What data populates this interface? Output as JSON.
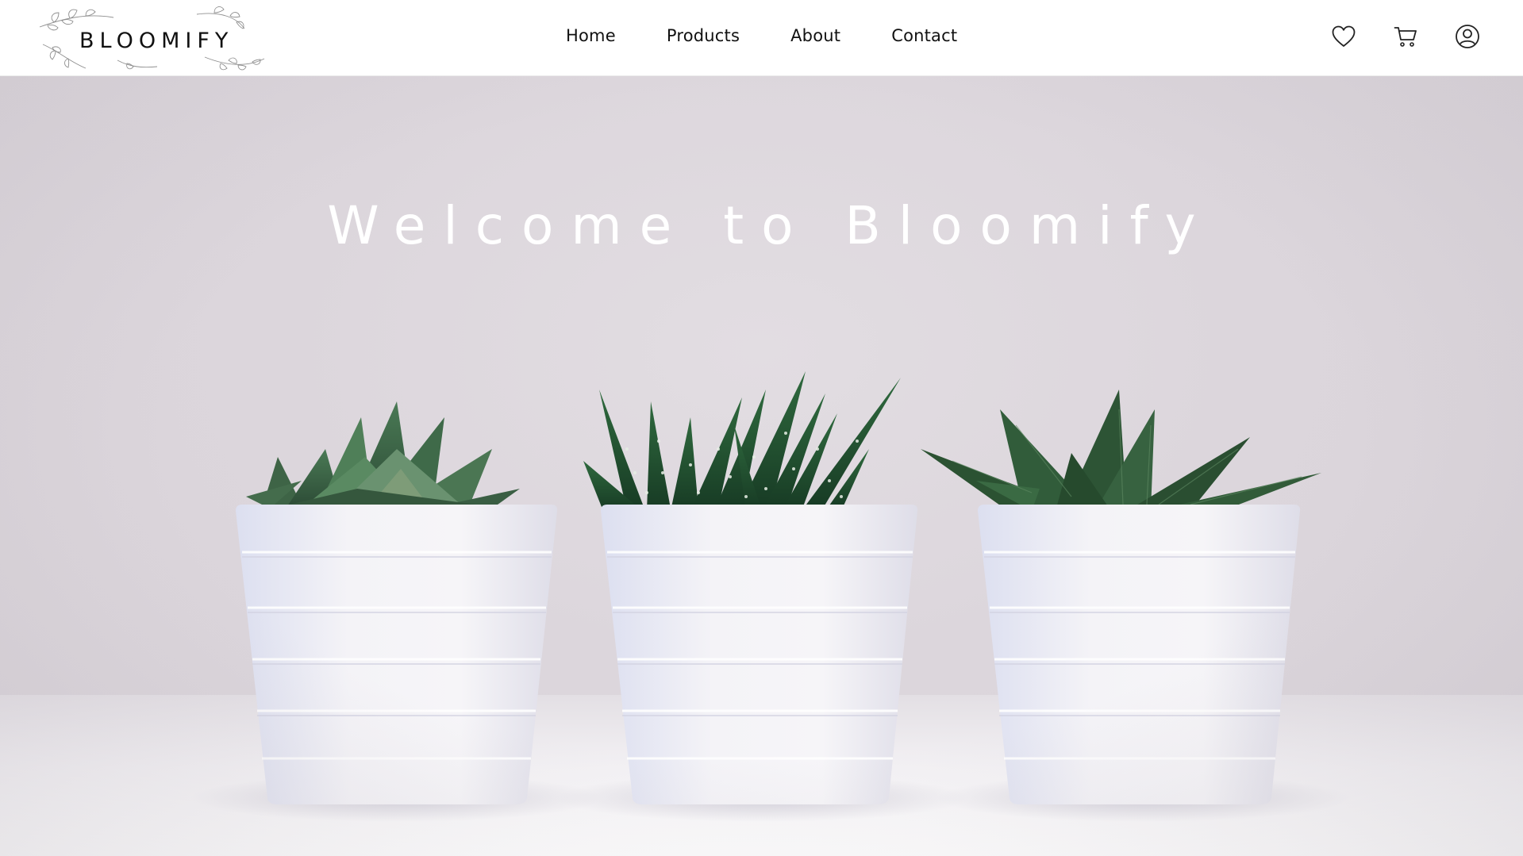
{
  "brand": {
    "name": "BLOOMIFY",
    "logo_icon": "leaf-wreath-icon"
  },
  "nav": {
    "items": [
      {
        "label": "Home"
      },
      {
        "label": "Products"
      },
      {
        "label": "About"
      },
      {
        "label": "Contact"
      }
    ]
  },
  "header_icons": [
    "heart-icon",
    "cart-icon",
    "user-icon"
  ],
  "hero": {
    "title": "Welcome to Bloomify",
    "image": "three succulents in white ribbed pots"
  },
  "colors": {
    "text": "#111111",
    "hero_title": "#ffffff",
    "hero_background": "#dcd6dc",
    "plant_green": "#2f5a3a"
  }
}
